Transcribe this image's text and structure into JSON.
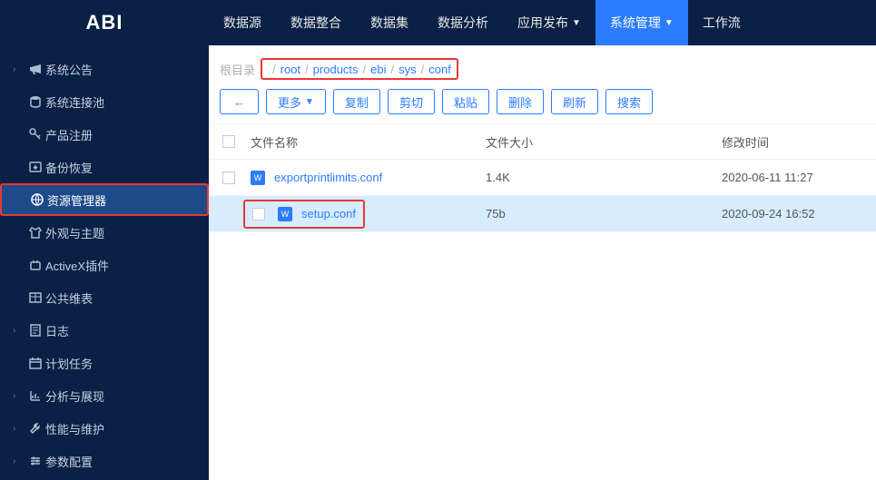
{
  "logo": "ABI",
  "topnav": [
    {
      "label": "数据源",
      "active": false,
      "caret": false
    },
    {
      "label": "数据整合",
      "active": false,
      "caret": false
    },
    {
      "label": "数据集",
      "active": false,
      "caret": false
    },
    {
      "label": "数据分析",
      "active": false,
      "caret": false
    },
    {
      "label": "应用发布",
      "active": false,
      "caret": true
    },
    {
      "label": "系统管理",
      "active": true,
      "caret": true
    },
    {
      "label": "工作流",
      "active": false,
      "caret": false
    }
  ],
  "sidebar": [
    {
      "label": "系统公告",
      "expand": true,
      "active": false,
      "icon": "megaphone"
    },
    {
      "label": "系统连接池",
      "expand": false,
      "active": false,
      "icon": "db"
    },
    {
      "label": "产品注册",
      "expand": false,
      "active": false,
      "icon": "key"
    },
    {
      "label": "备份恢复",
      "expand": false,
      "active": false,
      "icon": "backup"
    },
    {
      "label": "资源管理器",
      "expand": false,
      "active": true,
      "icon": "globe",
      "highlight": true
    },
    {
      "label": "外观与主题",
      "expand": false,
      "active": false,
      "icon": "shirt"
    },
    {
      "label": "ActiveX插件",
      "expand": false,
      "active": false,
      "icon": "plugin"
    },
    {
      "label": "公共维表",
      "expand": false,
      "active": false,
      "icon": "table"
    },
    {
      "label": "日志",
      "expand": true,
      "active": false,
      "icon": "log"
    },
    {
      "label": "计划任务",
      "expand": false,
      "active": false,
      "icon": "calendar"
    },
    {
      "label": "分析与展现",
      "expand": true,
      "active": false,
      "icon": "chart"
    },
    {
      "label": "性能与维护",
      "expand": true,
      "active": false,
      "icon": "wrench"
    },
    {
      "label": "参数配置",
      "expand": true,
      "active": false,
      "icon": "sliders"
    }
  ],
  "breadcrumb": {
    "root": "根目录",
    "path": [
      "root",
      "products",
      "ebi",
      "sys",
      "conf"
    ]
  },
  "toolbar": {
    "back_icon": "←",
    "more": "更多",
    "copy": "复制",
    "cut": "剪切",
    "paste": "粘贴",
    "delete": "删除",
    "refresh": "刷新",
    "search": "搜索"
  },
  "table": {
    "headers": {
      "name": "文件名称",
      "size": "文件大小",
      "time": "修改时间"
    },
    "rows": [
      {
        "name": "exportprintlimits.conf",
        "size": "1.4K",
        "time": "2020-06-11 11:27",
        "selected": false
      },
      {
        "name": "setup.conf",
        "size": "75b",
        "time": "2020-09-24 16:52",
        "selected": true,
        "highlight": true
      }
    ]
  }
}
